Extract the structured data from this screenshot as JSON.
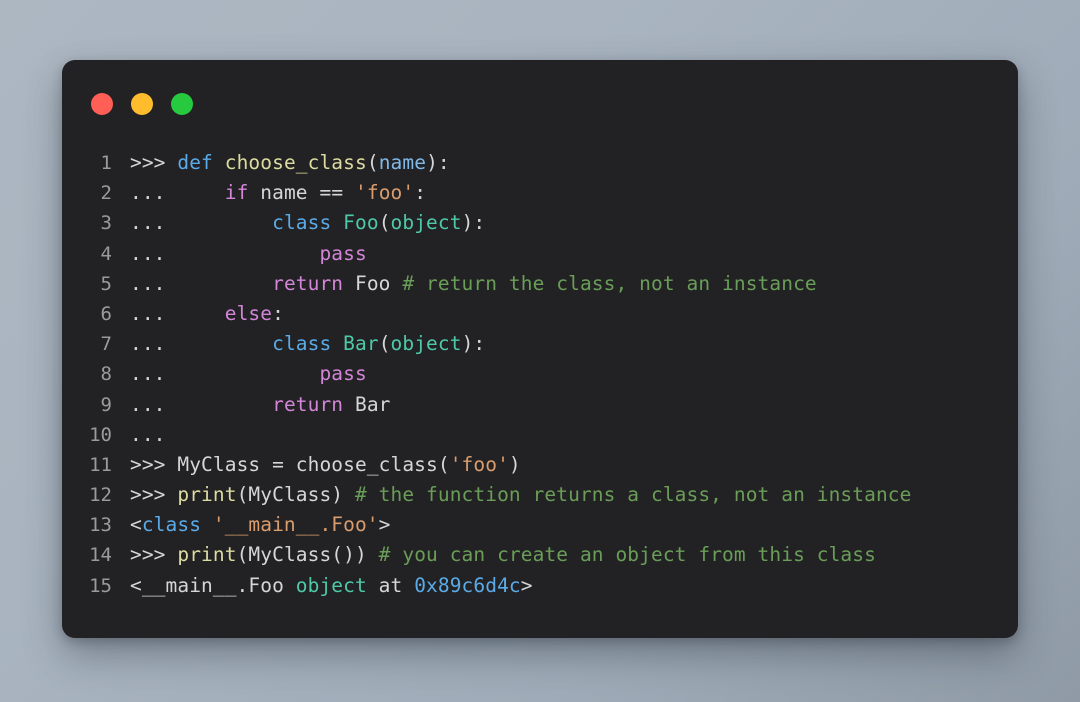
{
  "window": {
    "type": "code-snippet-card",
    "background_color": "#222224",
    "page_background": "#a7b2bf",
    "traffic_lights": [
      {
        "name": "close",
        "color": "#ff5f56"
      },
      {
        "name": "minimize",
        "color": "#ffbd2e"
      },
      {
        "name": "maximize",
        "color": "#27c93f"
      }
    ]
  },
  "theme": {
    "plain": "#d6d6d6",
    "prompt": "#d6d6d6",
    "keyword": "#d385d8",
    "declaration": "#5aabe8",
    "function": "#dcdba0",
    "parameter": "#80b8e8",
    "type": "#4ec9a8",
    "string": "#d99d6e",
    "comment": "#6a9e58",
    "number": "#5aabe8",
    "lineno": "#9b9b9b"
  },
  "code": {
    "language": "python",
    "first_line_number": 1,
    "line_count": 15,
    "plain_text": ">>> def choose_class(name):\n...     if name == 'foo':\n...         class Foo(object):\n...             pass\n...         return Foo # return the class, not an instance\n...     else:\n...         class Bar(object):\n...             pass\n...         return Bar\n...\n>>> MyClass = choose_class('foo')\n>>> print(MyClass) # the function returns a class, not an instance\n<class '__main__.Foo'>\n>>> print(MyClass()) # you can create an object from this class\n<__main__.Foo object at 0x89c6d4c>",
    "lines": [
      {
        "number": "1",
        "tokens": [
          {
            "text": ">>> ",
            "type": "prompt"
          },
          {
            "text": "def",
            "type": "decl"
          },
          {
            "text": " ",
            "type": "plain"
          },
          {
            "text": "choose_class",
            "type": "fn"
          },
          {
            "text": "(",
            "type": "plain"
          },
          {
            "text": "name",
            "type": "param"
          },
          {
            "text": "):",
            "type": "plain"
          }
        ]
      },
      {
        "number": "2",
        "tokens": [
          {
            "text": "... ",
            "type": "prompt"
          },
          {
            "text": "    ",
            "type": "plain"
          },
          {
            "text": "if",
            "type": "keyword"
          },
          {
            "text": " name ",
            "type": "plain"
          },
          {
            "text": "==",
            "type": "plain"
          },
          {
            "text": " ",
            "type": "plain"
          },
          {
            "text": "'foo'",
            "type": "str"
          },
          {
            "text": ":",
            "type": "plain"
          }
        ]
      },
      {
        "number": "3",
        "tokens": [
          {
            "text": "... ",
            "type": "prompt"
          },
          {
            "text": "        ",
            "type": "plain"
          },
          {
            "text": "class",
            "type": "decl"
          },
          {
            "text": " ",
            "type": "plain"
          },
          {
            "text": "Foo",
            "type": "type"
          },
          {
            "text": "(",
            "type": "plain"
          },
          {
            "text": "object",
            "type": "type"
          },
          {
            "text": "):",
            "type": "plain"
          }
        ]
      },
      {
        "number": "4",
        "tokens": [
          {
            "text": "... ",
            "type": "prompt"
          },
          {
            "text": "            ",
            "type": "plain"
          },
          {
            "text": "pass",
            "type": "keyword"
          }
        ]
      },
      {
        "number": "5",
        "tokens": [
          {
            "text": "... ",
            "type": "prompt"
          },
          {
            "text": "        ",
            "type": "plain"
          },
          {
            "text": "return",
            "type": "keyword"
          },
          {
            "text": " Foo ",
            "type": "plain"
          },
          {
            "text": "# return the class, not an instance",
            "type": "comment"
          }
        ]
      },
      {
        "number": "6",
        "tokens": [
          {
            "text": "... ",
            "type": "prompt"
          },
          {
            "text": "    ",
            "type": "plain"
          },
          {
            "text": "else",
            "type": "keyword"
          },
          {
            "text": ":",
            "type": "plain"
          }
        ]
      },
      {
        "number": "7",
        "tokens": [
          {
            "text": "... ",
            "type": "prompt"
          },
          {
            "text": "        ",
            "type": "plain"
          },
          {
            "text": "class",
            "type": "decl"
          },
          {
            "text": " ",
            "type": "plain"
          },
          {
            "text": "Bar",
            "type": "type"
          },
          {
            "text": "(",
            "type": "plain"
          },
          {
            "text": "object",
            "type": "type"
          },
          {
            "text": "):",
            "type": "plain"
          }
        ]
      },
      {
        "number": "8",
        "tokens": [
          {
            "text": "... ",
            "type": "prompt"
          },
          {
            "text": "            ",
            "type": "plain"
          },
          {
            "text": "pass",
            "type": "keyword"
          }
        ]
      },
      {
        "number": "9",
        "tokens": [
          {
            "text": "... ",
            "type": "prompt"
          },
          {
            "text": "        ",
            "type": "plain"
          },
          {
            "text": "return",
            "type": "keyword"
          },
          {
            "text": " Bar",
            "type": "plain"
          }
        ]
      },
      {
        "number": "10",
        "tokens": [
          {
            "text": "...",
            "type": "prompt"
          }
        ]
      },
      {
        "number": "11",
        "tokens": [
          {
            "text": ">>> ",
            "type": "prompt"
          },
          {
            "text": "MyClass = choose_class(",
            "type": "plain"
          },
          {
            "text": "'foo'",
            "type": "str"
          },
          {
            "text": ")",
            "type": "plain"
          }
        ]
      },
      {
        "number": "12",
        "tokens": [
          {
            "text": ">>> ",
            "type": "prompt"
          },
          {
            "text": "print",
            "type": "fn"
          },
          {
            "text": "(MyClass) ",
            "type": "plain"
          },
          {
            "text": "# the function returns a class, not an instance",
            "type": "comment"
          }
        ]
      },
      {
        "number": "13",
        "tokens": [
          {
            "text": "<",
            "type": "plain"
          },
          {
            "text": "class",
            "type": "decl"
          },
          {
            "text": " ",
            "type": "plain"
          },
          {
            "text": "'__main__.Foo'",
            "type": "str"
          },
          {
            "text": ">",
            "type": "plain"
          }
        ]
      },
      {
        "number": "14",
        "tokens": [
          {
            "text": ">>> ",
            "type": "prompt"
          },
          {
            "text": "print",
            "type": "fn"
          },
          {
            "text": "(MyClass()) ",
            "type": "plain"
          },
          {
            "text": "# you can create an object from this class",
            "type": "comment"
          }
        ]
      },
      {
        "number": "15",
        "tokens": [
          {
            "text": "<__main__.Foo ",
            "type": "plain"
          },
          {
            "text": "object",
            "type": "type"
          },
          {
            "text": " at ",
            "type": "plain"
          },
          {
            "text": "0x89c6d4c",
            "type": "num"
          },
          {
            "text": ">",
            "type": "plain"
          }
        ]
      }
    ]
  }
}
